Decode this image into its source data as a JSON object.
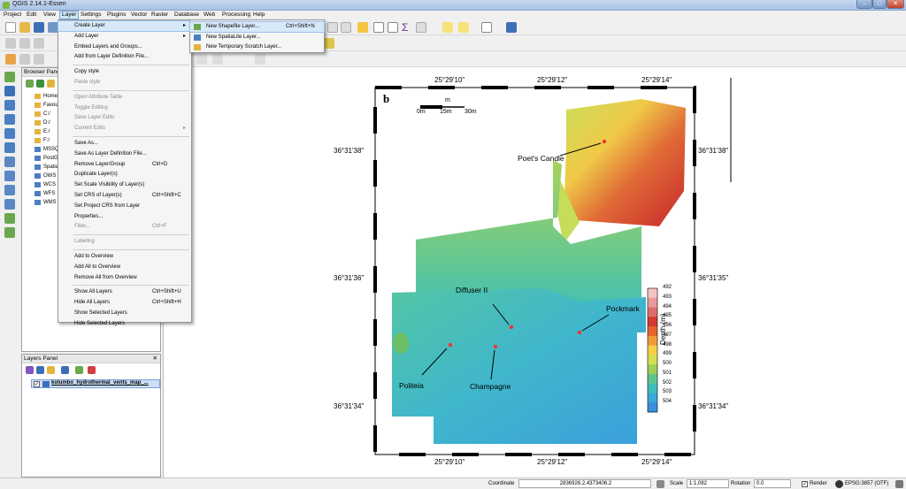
{
  "window": {
    "title": "QGIS 2.14.1-Essen"
  },
  "menubar": [
    "Project",
    "Edit",
    "View",
    "Layer",
    "Settings",
    "Plugins",
    "Vector",
    "Raster",
    "Database",
    "Web",
    "Processing",
    "Help"
  ],
  "layer_menu": [
    {
      "label": "Create Layer",
      "arrow": "▸",
      "hl": true
    },
    {
      "label": "Add Layer",
      "arrow": "▸"
    },
    {
      "label": "Embed Layers and Groups..."
    },
    {
      "label": "Add from Layer Definition File..."
    },
    {
      "sep": true
    },
    {
      "label": "Copy style"
    },
    {
      "label": "Paste style",
      "dis": true
    },
    {
      "sep": true
    },
    {
      "label": "Open Attribute Table",
      "dis": true
    },
    {
      "label": "Toggle Editing",
      "dis": true
    },
    {
      "label": "Save Layer Edits",
      "dis": true
    },
    {
      "label": "Current Edits",
      "dis": true,
      "arrow": "▸"
    },
    {
      "sep": true
    },
    {
      "label": "Save As..."
    },
    {
      "label": "Save As Layer Definition File..."
    },
    {
      "label": "Remove Layer/Group",
      "shortcut": "Ctrl+D"
    },
    {
      "label": "Duplicate Layer(s)"
    },
    {
      "label": "Set Scale Visibility of Layer(s)"
    },
    {
      "label": "Set CRS of Layer(s)",
      "shortcut": "Ctrl+Shift+C"
    },
    {
      "label": "Set Project CRS from Layer"
    },
    {
      "label": "Properties..."
    },
    {
      "label": "Filter...",
      "dis": true,
      "shortcut": "Ctrl+F"
    },
    {
      "sep": true
    },
    {
      "label": "Labeling",
      "dis": true
    },
    {
      "sep": true
    },
    {
      "label": "Add to Overview"
    },
    {
      "label": "Add All to Overview"
    },
    {
      "label": "Remove All from Overview"
    },
    {
      "sep": true
    },
    {
      "label": "Show All Layers",
      "shortcut": "Ctrl+Shift+U"
    },
    {
      "label": "Hide All Layers",
      "shortcut": "Ctrl+Shift+H"
    },
    {
      "label": "Show Selected Layers"
    },
    {
      "label": "Hide Selected Layers"
    }
  ],
  "create_submenu": [
    {
      "label": "New Shapefile Layer...",
      "shortcut": "Ctrl+Shift+N",
      "hl": true
    },
    {
      "label": "New SpatiaLite Layer..."
    },
    {
      "label": "New Temporary Scratch Layer..."
    }
  ],
  "browser": {
    "title": "Browser Panel",
    "items": [
      "Home",
      "Favou",
      "C:/",
      "D:/",
      "E:/",
      "F:/",
      "MSSQ",
      "PostG",
      "Spatia",
      "OWS",
      "WCS",
      "WFS",
      "WMS"
    ]
  },
  "layers_panel": {
    "title": "Layers Panel",
    "close": "✕",
    "layer_name": "kolumbo_hydrothermal_vents_map_..."
  },
  "map": {
    "panel_label": "b",
    "scale_unit": "m",
    "scale_ticks": [
      "0m",
      "15m",
      "30m"
    ],
    "lon_labels": [
      "25°29'10\"",
      "25°29'12\"",
      "25°29'14\""
    ],
    "lat_left": [
      "36°31'38\"",
      "36°31'36\"",
      "36°31'34\""
    ],
    "lat_right": [
      "36°31'38\"",
      "36°31'35\"",
      "36°31'34\""
    ],
    "legend_title": "Depth (m)",
    "legend_values": [
      "492",
      "493",
      "494",
      "495",
      "496",
      "497",
      "498",
      "499",
      "500",
      "501",
      "502",
      "503",
      "504"
    ],
    "legend_colors": [
      "#f2c4c4",
      "#e89a9a",
      "#de6e6e",
      "#d63a2f",
      "#e8622c",
      "#f29a3a",
      "#f6cf45",
      "#d4df4f",
      "#9fcf55",
      "#5fc58f",
      "#3fbdb8",
      "#3aa9d8",
      "#3c8fe0"
    ],
    "sites": [
      "Poet's Candle",
      "Diffuser II",
      "Pockmark",
      "Politeia",
      "Champagne"
    ]
  },
  "status": {
    "coord_label": "Coordinate",
    "coord_value": "2836926.2,4373406.2",
    "scale_label": "Scale",
    "scale_value": "1:1,082",
    "rotation_label": "Rotation",
    "rotation_value": "0.0",
    "render_label": "Render",
    "crs": "EPSG:3857 (OTF)"
  }
}
